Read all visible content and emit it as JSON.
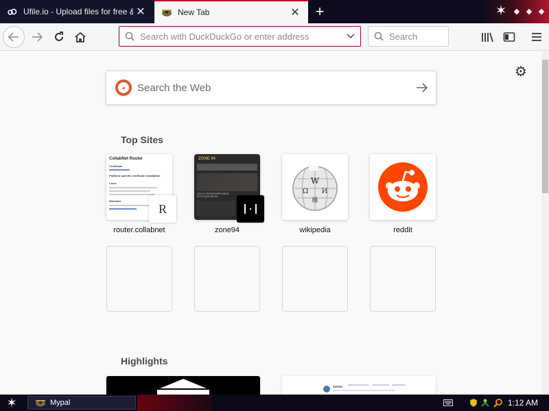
{
  "tabs": [
    {
      "title": "Ufile.io - Upload files for free & sh",
      "favicon": "cloud-icon",
      "active": false
    },
    {
      "title": "New Tab",
      "favicon": "new-tab-favicon",
      "active": true
    }
  ],
  "toolbar": {
    "url_placeholder": "Search with DuckDuckGo or enter address",
    "search_placeholder": "Search"
  },
  "newtab": {
    "web_search_placeholder": "Search the Web",
    "top_sites_title": "Top Sites",
    "highlights_title": "Highlights",
    "top_sites": [
      {
        "label": "router.collabnet",
        "badge": "R"
      },
      {
        "label": "zone94"
      },
      {
        "label": "wikipedia"
      },
      {
        "label": "reddit"
      }
    ],
    "router_thumb": {
      "heading": "CollabNet Router",
      "line1": "Certificate",
      "line2": "Platform specific certificate installation",
      "line3": "Linux",
      "line4": "Windows"
    },
    "zone94_thumb": {
      "banner": "ZONE 94",
      "caption": "CELLO CROSSOVER MUSIC · ROCK AND METAL"
    },
    "wikipedia_glyphs": [
      "W",
      "Ω",
      "И",
      "維"
    ]
  },
  "taskbar": {
    "task_label": "Mypal",
    "clock": "1:12 AM"
  },
  "colors": {
    "accent": "#c6002a",
    "reddit": "#ff4500",
    "duckduckgo": "#de5833",
    "tab_strip": "#0c0c1e"
  }
}
